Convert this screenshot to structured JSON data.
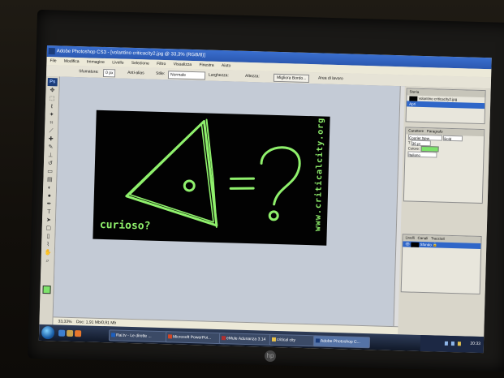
{
  "window": {
    "title": "Adobe Photoshop CS3 - [volantino criticacity2.jpg @ 33,3% (RGB/8)]"
  },
  "menu": [
    "File",
    "Modifica",
    "Immagine",
    "Livello",
    "Selezione",
    "Filtro",
    "Visualizza",
    "Finestra",
    "Aiuto"
  ],
  "options": {
    "feather_label": "Sfumatura:",
    "feather_value": "0 px",
    "antialias": "Anti-alias",
    "style_label": "Stile:",
    "style_value": "Normale",
    "width_label": "Larghezza:",
    "height_label": "Altezza:",
    "refine_button": "Migliora Bordo...",
    "workspace": "Area di lavoro"
  },
  "toolbox": {
    "logo": "Ps"
  },
  "artwork": {
    "caption": "curioso?",
    "url": "www.criticalcity.org",
    "accent": "#8ff06c"
  },
  "status_bar": {
    "zoom": "33,33%",
    "doc": "Doc: 1,91 Mb/0,91 Mb"
  },
  "panels": {
    "history_title": "Storia",
    "history_file": "volantino criticacity2.jpg",
    "history_item": "Apri",
    "char_title": "Carattere",
    "para_title": "Paragrafo",
    "font_value": "Courier New",
    "font_style": "Bold",
    "size_value": "36 pt",
    "color_label": "Colore:",
    "language": "Italiano",
    "layers_title": "Livelli",
    "channels_title": "Canali",
    "paths_title": "Tracciati",
    "layer_name": "Sfondo"
  },
  "taskbar": {
    "tasks": [
      "Rai.tv - Le dirette ...",
      "Microsoft PowerPoi...",
      "eMule Adunanza 3.14",
      "critical city",
      "Adobe Photoshop C..."
    ],
    "active_index": 4,
    "clock": "20:33"
  }
}
